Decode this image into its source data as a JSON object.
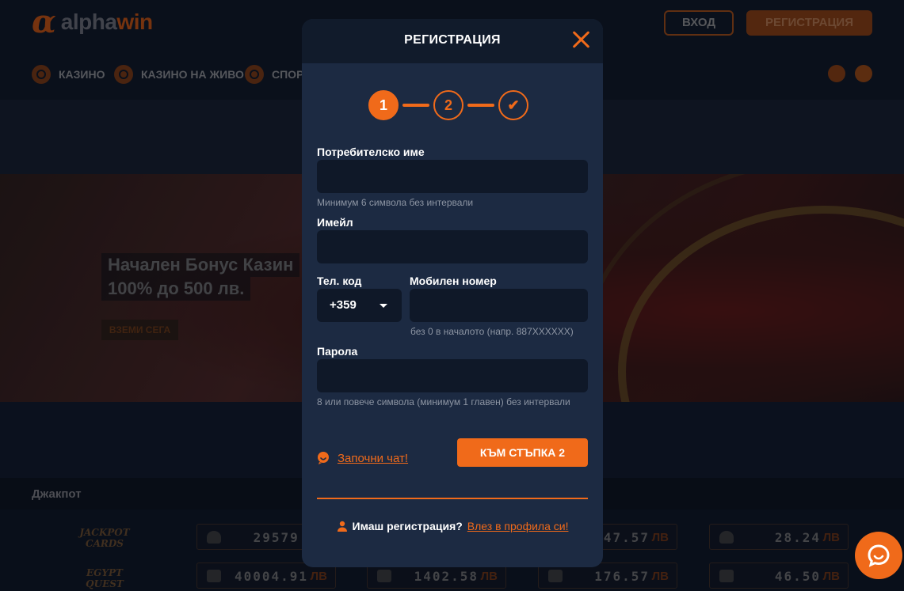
{
  "header": {
    "logo_alpha": "α",
    "logo_word1": "alpha",
    "logo_word2": "win",
    "login_label": "ВХОД",
    "register_label": "РЕГИСТРАЦИЯ"
  },
  "nav": {
    "items": [
      {
        "label": "КАЗИНО",
        "icon": "roulette-icon"
      },
      {
        "label": "КАЗИНО НА ЖИВО",
        "icon": "live-icon"
      },
      {
        "label": "СПОРТ",
        "icon": "ball-icon"
      }
    ],
    "right_icons": [
      "chat-icon",
      "sun-icon"
    ]
  },
  "hero": {
    "title_line1": "Начален Бонус Казин",
    "title_line2": "100% до 500 лв.",
    "cta": "ВЗЕМИ СЕГА"
  },
  "jackpot": {
    "title": "Джакпот",
    "rows": [
      {
        "logo": "JACKPOT CARDS",
        "values": [
          "29579.0",
          "",
          "47.57",
          "28.24"
        ],
        "currency": "ЛВ"
      },
      {
        "logo": "EGYPT QUEST",
        "values": [
          "40004.91",
          "1402.58",
          "176.57",
          "46.50"
        ],
        "currency": "ЛВ"
      }
    ]
  },
  "modal": {
    "title": "РЕГИСТРАЦИЯ",
    "steps": [
      "1",
      "2",
      "✔"
    ],
    "username": {
      "label": "Потребителско име",
      "value": "",
      "hint": "Минимум 6 символа без интервали"
    },
    "email": {
      "label": "Имейл",
      "value": ""
    },
    "phone_code": {
      "label": "Тел. код",
      "value": "+359"
    },
    "mobile": {
      "label": "Мобилен номер",
      "value": "",
      "hint": "без 0 в началото (напр. 887XXXXXX)"
    },
    "password": {
      "label": "Парола",
      "value": "",
      "hint": "8 или повече символа (минимум 1 главен) без интервали"
    },
    "chat_link": "Започни чат!",
    "next_button": "КЪМ СТЪПКА 2",
    "login_question": "Имаш регистрация?",
    "login_link": "Влез в профила си!"
  },
  "colors": {
    "accent": "#f06a1a",
    "modal_bg": "#1c2a42",
    "input_bg": "#0f1828"
  }
}
